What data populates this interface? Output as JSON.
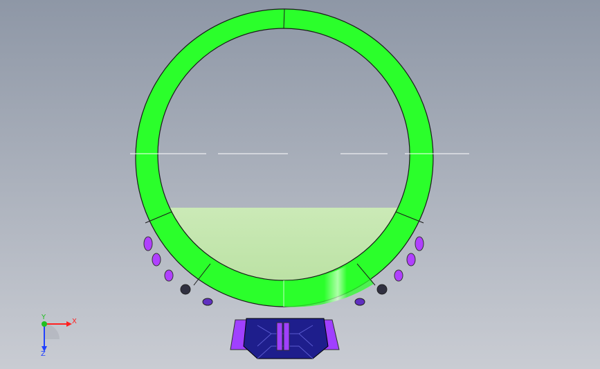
{
  "viewport": {
    "background_top": "#8e97a6",
    "background_bottom": "#c8ccd4"
  },
  "model": {
    "band_color": "#2bff2b",
    "band_highlight": "#e8ffe0",
    "band_inner_edge": "#f0ffe8",
    "setting_color": "#a040ff",
    "gem_color": "#1e1e8c",
    "side_stone_color": "#b040ff"
  },
  "triad": {
    "x_label": "X",
    "y_label": "Y",
    "z_label": "Z",
    "x_color": "#ff2020",
    "y_color": "#20c020",
    "z_color": "#2040ff"
  }
}
